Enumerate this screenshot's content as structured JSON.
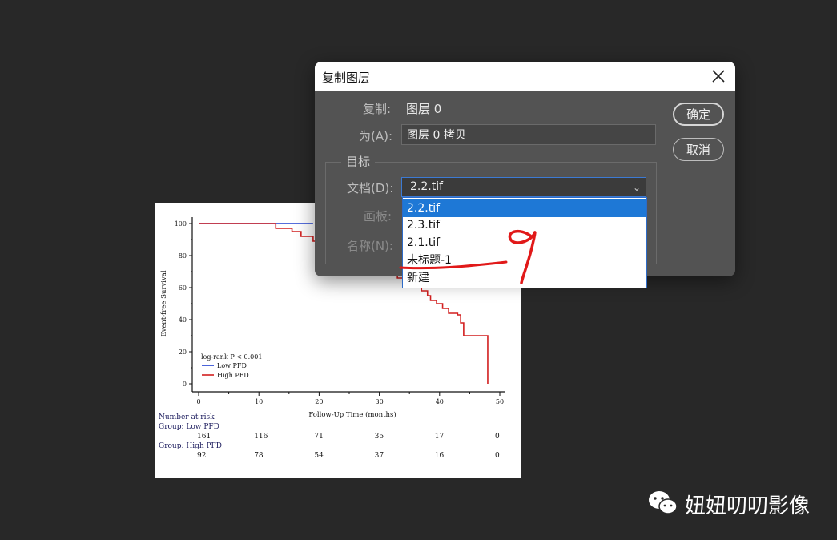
{
  "dialog": {
    "title": "复制图层",
    "copy_label": "复制:",
    "copy_value": "图层 0",
    "as_label": "为(A):",
    "as_value": "图层 0 拷贝",
    "target_label": "目标",
    "document_label": "文档(D):",
    "document_value": "2.2.tif",
    "artboard_label": "画板:",
    "name_label": "名称(N):",
    "ok_label": "确定",
    "cancel_label": "取消",
    "document_options": [
      "2.2.tif",
      "2.3.tif",
      "2.1.tif",
      "未标题-1",
      "新建"
    ],
    "selected_option_index": 0
  },
  "watermark": {
    "text": "妞妞叨叨影像",
    "icon": "wechat-icon"
  },
  "colors": {
    "accent": "#1e78d6",
    "low_series": "#1f3fd1",
    "high_series": "#d21f1f",
    "annotation": "#e11919"
  },
  "chart_data": {
    "type": "line",
    "title": "",
    "xlabel": "Follow-Up Time (months)",
    "ylabel": "Event-free Survival",
    "xlim": [
      0,
      50
    ],
    "ylim": [
      0,
      100
    ],
    "xticks": [
      0,
      10,
      20,
      30,
      40,
      50
    ],
    "yticks": [
      0,
      20,
      40,
      60,
      80,
      100
    ],
    "annotation": "log-rank P < 0.001",
    "series": [
      {
        "name": "Low PFD",
        "color": "#1f3fd1",
        "x": [
          0,
          19
        ],
        "y": [
          100,
          100
        ]
      },
      {
        "name": "High PFD",
        "color": "#d21f1f",
        "x": [
          0,
          12,
          12.8,
          15.5,
          17,
          19,
          21,
          24,
          28,
          31,
          33,
          35,
          37,
          38,
          38.5,
          39.5,
          40.5,
          41.5,
          43,
          43.5,
          44,
          48,
          48
        ],
        "y": [
          100,
          100,
          97,
          95,
          92,
          89,
          86,
          80,
          74,
          70,
          66,
          62,
          58,
          55,
          52,
          50,
          47,
          44,
          43,
          38,
          30,
          25,
          0
        ]
      }
    ],
    "risk_table": {
      "header": "Number at risk",
      "groups": [
        {
          "label": "Group: Low PFD",
          "values": [
            "161",
            "116",
            "71",
            "35",
            "17",
            "0"
          ]
        },
        {
          "label": "Group: High PFD",
          "values": [
            "92",
            "78",
            "54",
            "37",
            "16",
            "0"
          ]
        }
      ]
    }
  }
}
